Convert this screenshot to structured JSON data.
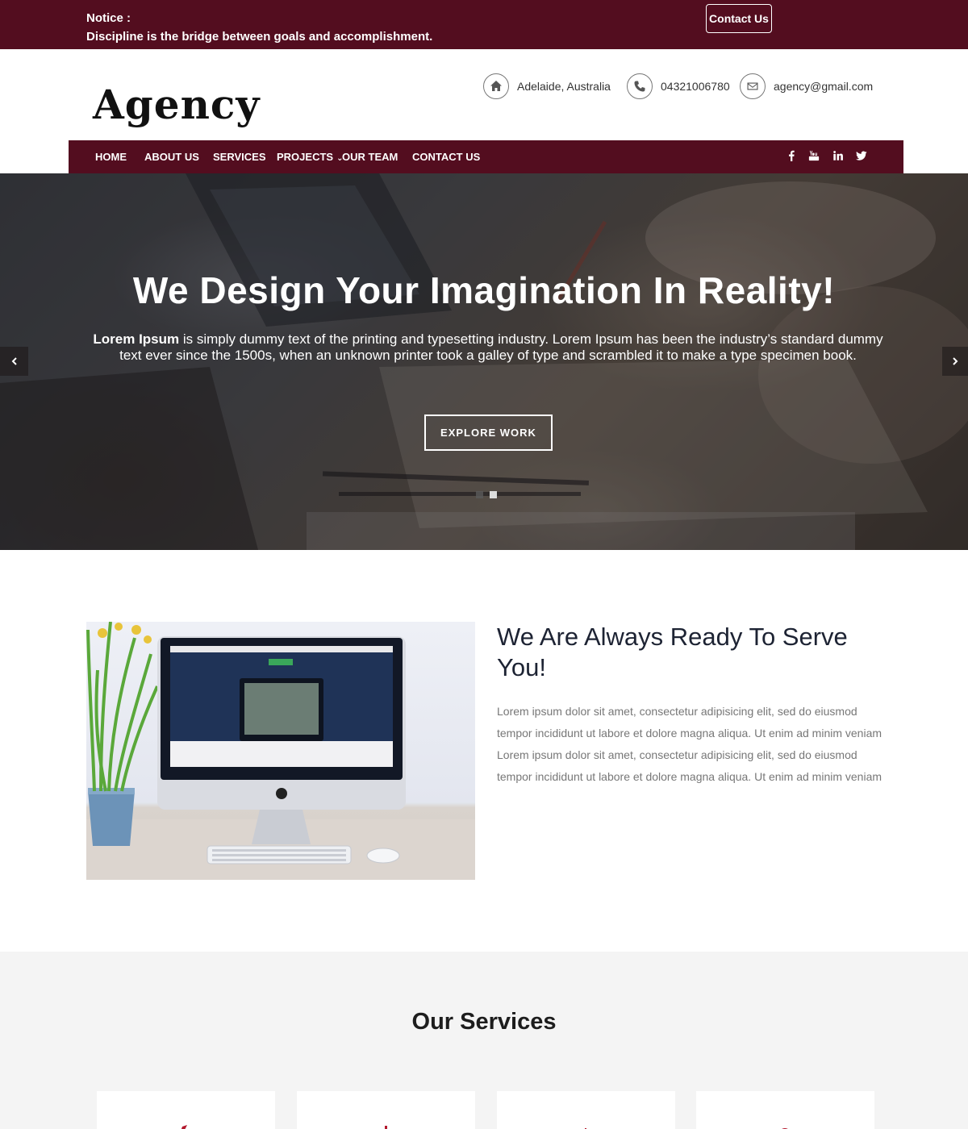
{
  "notice": {
    "title": "Notice :",
    "text": "Discipline is the bridge between goals and accomplishment.",
    "contact_button": "Contact Us"
  },
  "header": {
    "logo": "Agency",
    "address": "Adelaide, Australia",
    "phone": "04321006780",
    "email": "agency@gmail.com"
  },
  "nav": {
    "items": [
      "HOME",
      "ABOUT US",
      "SERVICES",
      "PROJECTS",
      "OUR TEAM",
      "CONTACT US"
    ],
    "social": [
      "facebook-icon",
      "youtube-icon",
      "linkedin-icon",
      "twitter-icon"
    ]
  },
  "hero": {
    "title": "We Design Your Imagination In Reality!",
    "text_bold": "Lorem Ipsum",
    "text": " is simply dummy text of the printing and typesetting industry. Lorem Ipsum has been the industry’s standard dummy text ever since the 1500s, when an unknown printer took a galley of type and scrambled it to make a type specimen book.",
    "button": "EXPLORE WORK",
    "slides": 2,
    "active_slide": 2
  },
  "about": {
    "title": "We Are Always Ready To Serve You!",
    "text": "Lorem ipsum dolor sit amet, consectetur adipisicing elit, sed do eiusmod tempor incididunt ut labore et dolore magna aliqua. Ut enim ad minim veniam Lorem ipsum dolor sit amet, consectetur adipisicing elit, sed do eiusmod tempor incididunt ut labore et dolore magna aliqua. Ut enim ad minim veniam"
  },
  "services": {
    "title": "Our Services"
  },
  "colors": {
    "brand": "#530d1f",
    "accent_icon": "#b3192e"
  }
}
